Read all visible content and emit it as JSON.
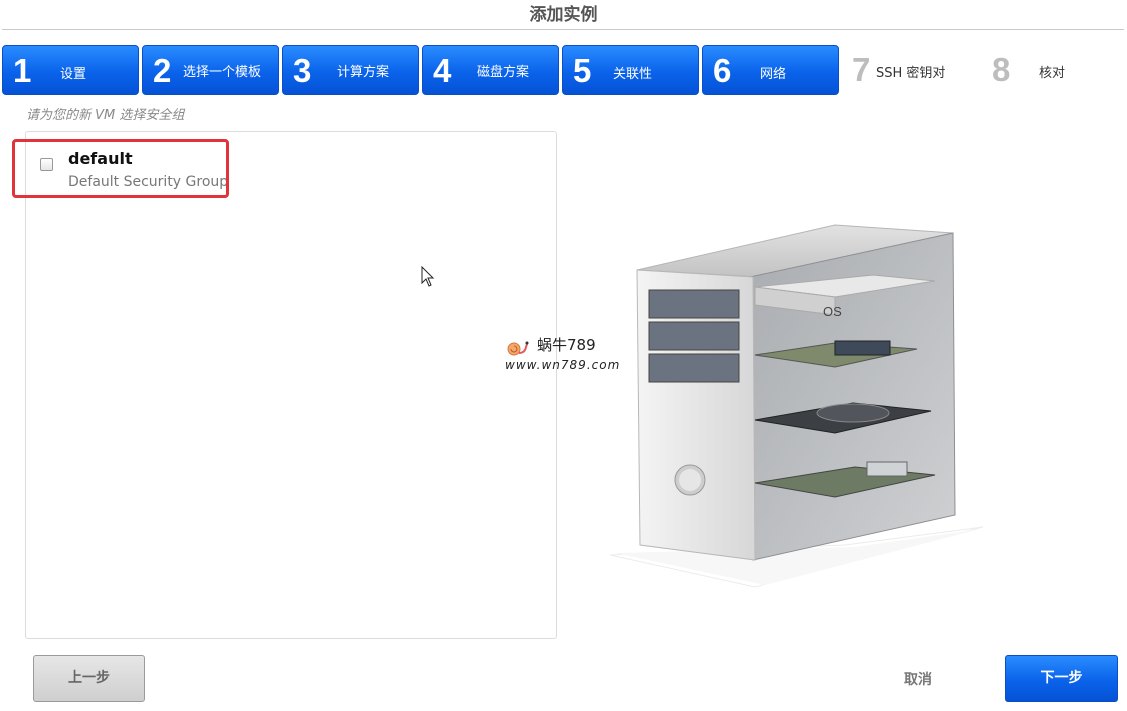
{
  "dialog": {
    "title": "添加实例"
  },
  "steps": [
    {
      "num": "1",
      "label": "设置",
      "active": true
    },
    {
      "num": "2",
      "label": "选择一个模板",
      "active": true
    },
    {
      "num": "3",
      "label": "计算方案",
      "active": true
    },
    {
      "num": "4",
      "label": "磁盘方案",
      "active": true
    },
    {
      "num": "5",
      "label": "关联性",
      "active": true
    },
    {
      "num": "6",
      "label": "网络",
      "active": true
    },
    {
      "num": "7",
      "label": "SSH 密钥对",
      "active": false
    },
    {
      "num": "8",
      "label": "核对",
      "active": false
    }
  ],
  "security_group": {
    "hint": "请为您的新 VM 选择安全组",
    "items": [
      {
        "name": "default",
        "description": "Default Security Group",
        "checked": false
      }
    ]
  },
  "illustration": {
    "disk_label": "OS"
  },
  "watermark": {
    "brand": "蜗牛789",
    "url": "www.wn789.com"
  },
  "buttons": {
    "prev": "上一步",
    "cancel": "取消",
    "next": "下一步"
  },
  "colors": {
    "accent": "#0a63ea",
    "highlight": "#e0333a"
  }
}
